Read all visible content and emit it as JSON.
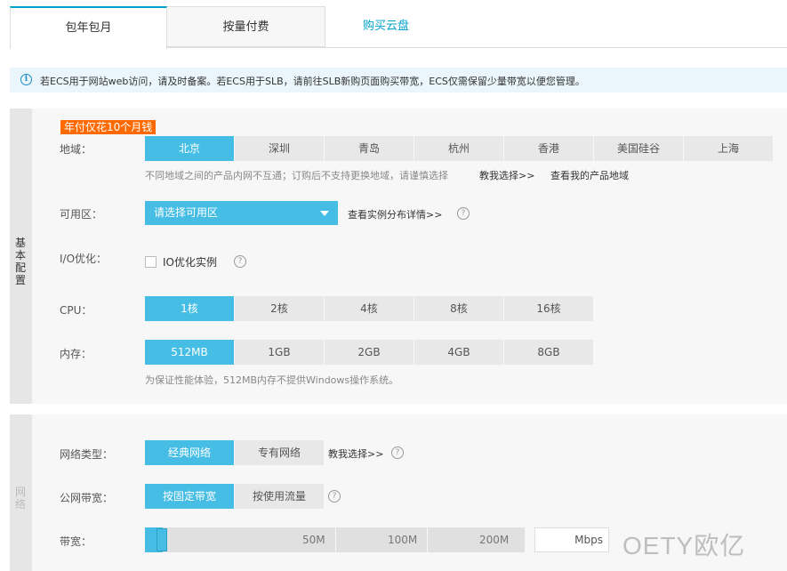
{
  "tabs": {
    "yearly": "包年包月",
    "payg": "按量付费",
    "buy_disk": "购买云盘"
  },
  "notice": {
    "icon": "info-icon",
    "text": "若ECS用于网站web访问，请及时备案。若ECS用于SLB，请前往SLB新购页面购买带宽，ECS仅需保留少量带宽以便您管理。"
  },
  "basic": {
    "side_label": "基本配置",
    "promo": "年付仅花10个月钱",
    "region": {
      "label": "地域：",
      "options": [
        "北京",
        "深圳",
        "青岛",
        "杭州",
        "香港",
        "美国硅谷",
        "上海"
      ],
      "selected": "北京",
      "hint": "不同地域之间的产品内网不互通；订购后不支持更换地域，请谨慎选择",
      "help_link": "教我选择>>",
      "my_regions_link": "查看我的产品地域"
    },
    "zone": {
      "label": "可用区：",
      "placeholder": "请选择可用区",
      "detail_link": "查看实例分布详情>>"
    },
    "io": {
      "label": "I/O优化：",
      "checkbox_label": "IO优化实例"
    },
    "cpu": {
      "label": "CPU：",
      "options": [
        "1核",
        "2核",
        "4核",
        "8核",
        "16核"
      ],
      "selected": "1核"
    },
    "memory": {
      "label": "内存：",
      "options": [
        "512MB",
        "1GB",
        "2GB",
        "4GB",
        "8GB"
      ],
      "selected": "512MB",
      "hint": "为保证性能体验，512MB内存不提供Windows操作系统。"
    }
  },
  "network": {
    "side_label": "网络",
    "type": {
      "label": "网络类型：",
      "options": [
        "经典网络",
        "专有网络"
      ],
      "selected": "经典网络",
      "help_link": "教我选择>>"
    },
    "bandwidth_mode": {
      "label": "公网带宽：",
      "options": [
        "按固定带宽",
        "按使用流量"
      ],
      "selected": "按固定带宽"
    },
    "bandwidth": {
      "label": "带宽：",
      "ticks": [
        "50M",
        "100M",
        "200M"
      ],
      "unit": "Mbps",
      "value": ""
    }
  },
  "watermark": "OETY欧亿",
  "colors": {
    "accent": "#45bde4",
    "promo": "#ff6a00",
    "link": "#00a2ca"
  }
}
